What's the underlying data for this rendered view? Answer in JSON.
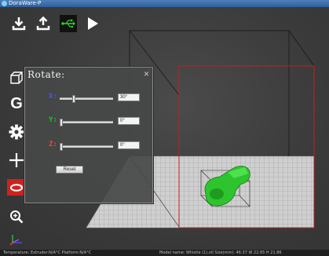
{
  "window": {
    "title": "DoraWare-P"
  },
  "toolbar": {
    "items": [
      {
        "name": "download-icon"
      },
      {
        "name": "upload-icon"
      },
      {
        "name": "usb-icon"
      },
      {
        "name": "play-icon"
      }
    ]
  },
  "left_toolbar": {
    "items": [
      {
        "name": "cube-view-icon"
      },
      {
        "name": "gcode-icon",
        "glyph": "G"
      },
      {
        "name": "settings-gear-icon"
      },
      {
        "name": "move-crosshair-icon"
      },
      {
        "name": "rotate-icon",
        "active": true
      },
      {
        "name": "zoom-in-icon"
      },
      {
        "name": "axes-icon"
      }
    ]
  },
  "rotate_panel": {
    "title": "Rotate:",
    "close_glyph": "×",
    "rows": [
      {
        "axis": "X:",
        "color": "#3b5bff",
        "value": "30°",
        "fraction": 0.25
      },
      {
        "axis": "Y:",
        "color": "#22c522",
        "value": "0°",
        "fraction": 0.0
      },
      {
        "axis": "Z:",
        "color": "#ff3b3b",
        "value": "0°",
        "fraction": 0.0
      }
    ],
    "reset_label": "Reset"
  },
  "status": {
    "left": "Temperature: Extruder:N/A°C Platform:N/A°C",
    "right": "Model name: Whistle (1).stl    Size(mm): 46.37 W 22.65 H 21.86"
  },
  "colors": {
    "box_red": "#c02020",
    "box_dark": "#1a1a1a",
    "model_green": "#2ec42e",
    "grid_light": "#d0d0d0"
  }
}
